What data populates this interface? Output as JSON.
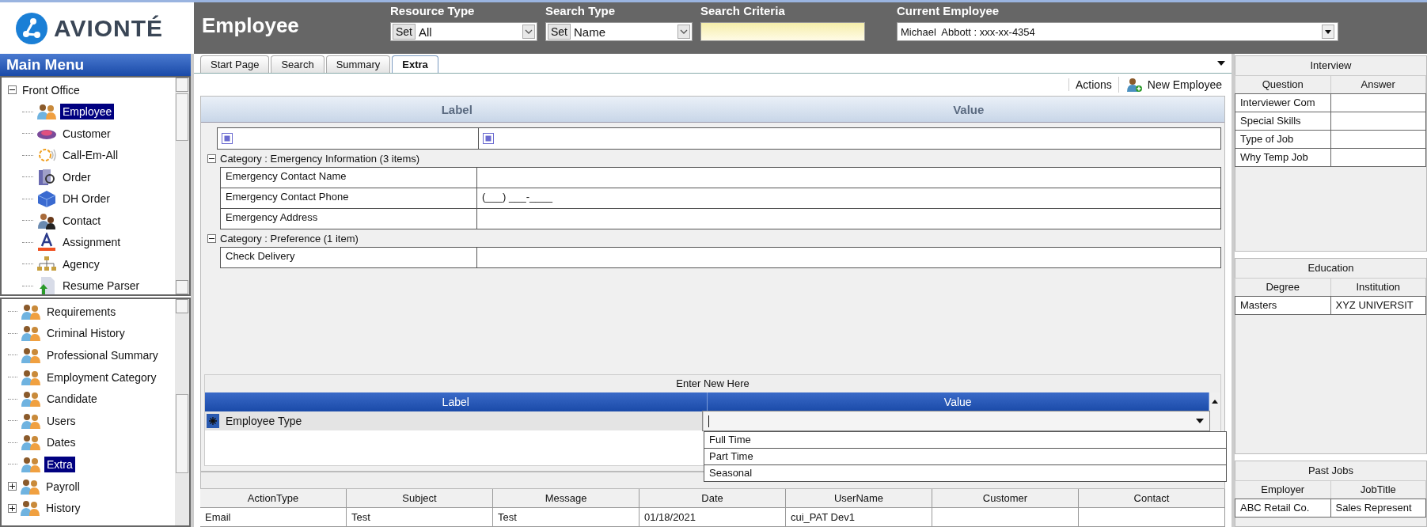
{
  "logo": {
    "text": "AVIONTÉ"
  },
  "header": {
    "title": "Employee",
    "fields": [
      {
        "kind": "combo",
        "label": "Resource Type",
        "button": "Set",
        "value": "All"
      },
      {
        "kind": "combo",
        "label": "Search Type",
        "button": "Set",
        "value": "Name"
      },
      {
        "kind": "text",
        "label": "Search Criteria"
      },
      {
        "kind": "select",
        "label": "Current Employee",
        "value": "Michael  Abbott : xxx-xx-4354"
      }
    ]
  },
  "main_menu": {
    "title": "Main Menu",
    "upper_tree": {
      "label": "Front Office",
      "expanded": true,
      "children": [
        {
          "label": "Employee",
          "kind": "people",
          "selected": true
        },
        {
          "label": "Customer",
          "kind": "disc",
          "selected": false
        },
        {
          "label": "Call-Em-All",
          "kind": "ring",
          "selected": false
        },
        {
          "label": "Order",
          "kind": "book",
          "selected": false
        },
        {
          "label": "DH Order",
          "kind": "cube",
          "selected": false
        },
        {
          "label": "Contact",
          "kind": "contact",
          "selected": false
        },
        {
          "label": "Assignment",
          "kind": "letter",
          "selected": false
        },
        {
          "label": "Agency",
          "kind": "org",
          "selected": false
        },
        {
          "label": "Resume Parser",
          "kind": "document",
          "selected": false
        }
      ]
    },
    "lower_tree": [
      {
        "label": "Requirements",
        "selected": false
      },
      {
        "label": "Criminal History",
        "selected": false
      },
      {
        "label": "Professional Summary",
        "selected": false
      },
      {
        "label": "Employment Category",
        "selected": false
      },
      {
        "label": "Candidate",
        "selected": false
      },
      {
        "label": "Users",
        "selected": false
      },
      {
        "label": "Dates",
        "selected": false
      },
      {
        "label": "Extra",
        "selected": true
      },
      {
        "label": "Payroll",
        "selected": false,
        "expanded": false
      },
      {
        "label": "History",
        "selected": false,
        "expanded": false
      }
    ]
  },
  "tabs": [
    {
      "label": "Start Page",
      "selected": false
    },
    {
      "label": "Search",
      "selected": false
    },
    {
      "label": "Summary",
      "selected": false
    },
    {
      "label": "Extra",
      "selected": true
    }
  ],
  "actions": {
    "actions_label": "Actions",
    "new_button": "New Employee"
  },
  "grid": {
    "columns": [
      "Label",
      "Value"
    ],
    "categories": [
      {
        "title": "Category : Emergency Information (3 items)",
        "expanded": true,
        "rows": [
          {
            "label": "Emergency Contact Name"
          },
          {
            "label": "Emergency Contact Phone",
            "value": "(___) ___-____"
          },
          {
            "label": "Emergency Address"
          }
        ]
      },
      {
        "title": "Category : Preference (1 item)",
        "expanded": true,
        "rows": [
          {
            "label": "Check Delivery"
          }
        ]
      }
    ]
  },
  "enter_new": {
    "title": "Enter New Here",
    "columns": [
      "Label",
      "Value"
    ],
    "row": {
      "label": "Employee Type"
    },
    "dropdown": {
      "expanded": true,
      "options": [
        "Full Time",
        "Part Time",
        "Seasonal"
      ]
    }
  },
  "activity_table": {
    "columns": [
      "ActionType",
      "Subject",
      "Message",
      "Date",
      "UserName",
      "Customer",
      "Contact"
    ],
    "rows": [
      [
        "Email",
        "Test",
        "Test",
        "01/18/2021",
        "cui_PAT Dev1"
      ]
    ]
  },
  "side_panels": [
    {
      "title": "Interview",
      "columns": [
        "Question",
        "Answer"
      ],
      "rows": [
        [
          "Interviewer Com"
        ],
        [
          "Special Skills"
        ],
        [
          "Type of Job"
        ],
        [
          "Why Temp Job"
        ]
      ]
    },
    {
      "title": "Education",
      "columns": [
        "Degree",
        "Institution"
      ],
      "rows": [
        [
          "Masters",
          "XYZ UNIVERSIT"
        ]
      ]
    },
    {
      "title": "Past Jobs",
      "columns": [
        "Employer",
        "JobTitle"
      ],
      "rows": [
        [
          "ABC Retail Co.",
          "Sales Represent"
        ]
      ]
    }
  ]
}
